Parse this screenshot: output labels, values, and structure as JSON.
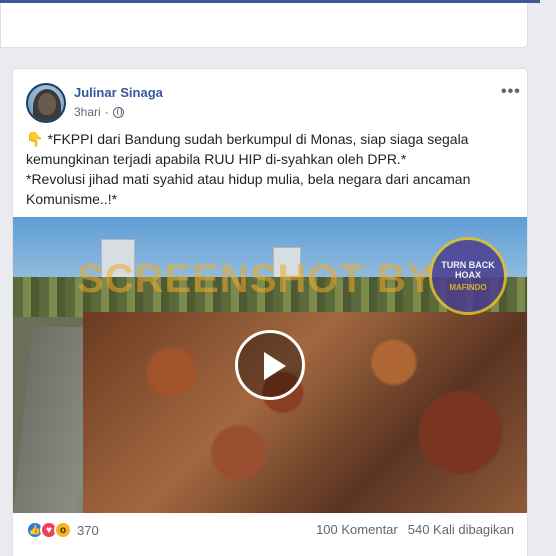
{
  "post": {
    "author": "Julinar Sinaga",
    "time": "3hari",
    "more_label": "•••",
    "pointer_emoji": "👇",
    "lines": [
      "*FKPPI dari Bandung sudah berkumpul di Monas, siap siaga segala",
      "kemungkinan terjadi apabila RUU HIP di-syahkan oleh DPR.*",
      "*Revolusi jihad mati syahid atau hidup mulia, bela negara dari ancaman",
      "Komunisme..!*"
    ],
    "video": {
      "watermark": "SCREENSHOT BY",
      "badge_text": "TURN BACK HOAX",
      "badge_sub": "MAFINDO"
    },
    "reactions": {
      "icons": [
        "like-icon",
        "love-icon",
        "wow-icon"
      ],
      "count": "370"
    },
    "comments": "100 Komentar",
    "shares": "540 Kali dibagikan"
  },
  "colors": {
    "topbar": "#3b5998",
    "author_link": "#385898",
    "background": "#e9ebee"
  }
}
